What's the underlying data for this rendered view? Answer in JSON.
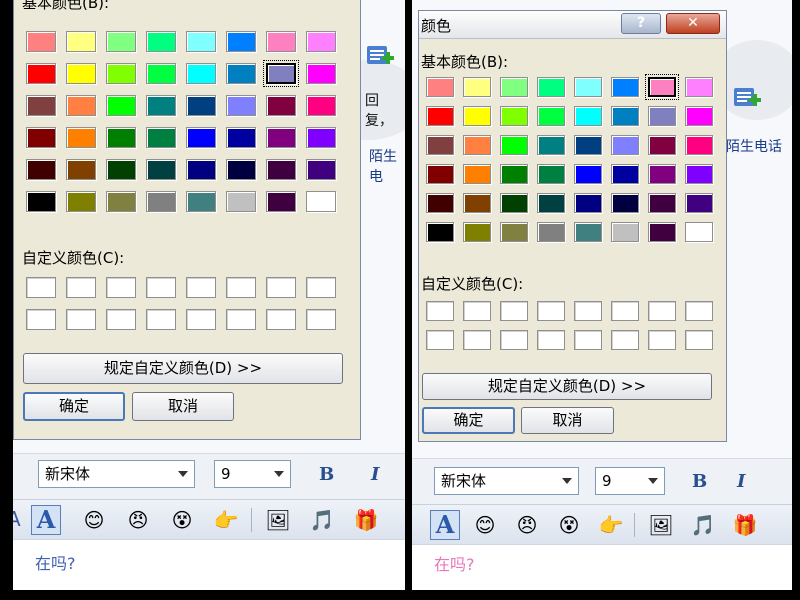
{
  "left": {
    "dialog": {
      "basic_label": "基本颜色(B):",
      "custom_label": "自定义颜色(C):",
      "define_btn": "规定自定义颜色(D) >>",
      "ok_btn": "确定",
      "cancel_btn": "取消"
    },
    "side": {
      "frag1": "回复，",
      "frag2": "陌生电"
    },
    "toolbar": {
      "font": "新宋体",
      "size": "9",
      "bold": "B",
      "italic": "I",
      "font_btn": "A",
      "left_edge": "A"
    },
    "message": {
      "text": "在吗?",
      "color": "#4060b0"
    },
    "selected_swatch": "row 2, column 7"
  },
  "right": {
    "dialog": {
      "title": "颜色",
      "help_btn": "?",
      "close_btn": "✕",
      "basic_label": "基本颜色(B):",
      "custom_label": "自定义颜色(C):",
      "define_btn": "规定自定义颜色(D) >>",
      "ok_btn": "确定",
      "cancel_btn": "取消"
    },
    "side": {
      "frag2": "陌生电话"
    },
    "toolbar": {
      "font": "新宋体",
      "size": "9",
      "bold": "B",
      "italic": "I",
      "font_btn": "A",
      "left_edge": "A"
    },
    "message": {
      "text": "在吗?",
      "color": "#e878b8"
    },
    "selected_swatch": "row 1, column 7"
  },
  "basic_colors": [
    [
      "#ff8080",
      "#ffff80",
      "#80ff80",
      "#00ff80",
      "#80ffff",
      "#0080ff",
      "#ff80c0",
      "#ff80ff"
    ],
    [
      "#ff0000",
      "#ffff00",
      "#80ff00",
      "#00ff40",
      "#00ffff",
      "#0080c0",
      "#8080c0",
      "#ff00ff"
    ],
    [
      "#804040",
      "#ff8040",
      "#00ff00",
      "#008080",
      "#004080",
      "#8080ff",
      "#800040",
      "#ff0080"
    ],
    [
      "#800000",
      "#ff8000",
      "#008000",
      "#008040",
      "#0000ff",
      "#0000a0",
      "#800080",
      "#8000ff"
    ],
    [
      "#400000",
      "#804000",
      "#004000",
      "#004040",
      "#000080",
      "#000040",
      "#400040",
      "#400080"
    ],
    [
      "#000000",
      "#808000",
      "#808040",
      "#808080",
      "#408080",
      "#c0c0c0",
      "#400040",
      "#ffffff"
    ]
  ],
  "icons": [
    "smile-icon",
    "angry-face-icon",
    "sticker-icon",
    "hand-point-icon",
    "image-icon",
    "music-note-icon",
    "gift-icon",
    "screen-icon"
  ]
}
